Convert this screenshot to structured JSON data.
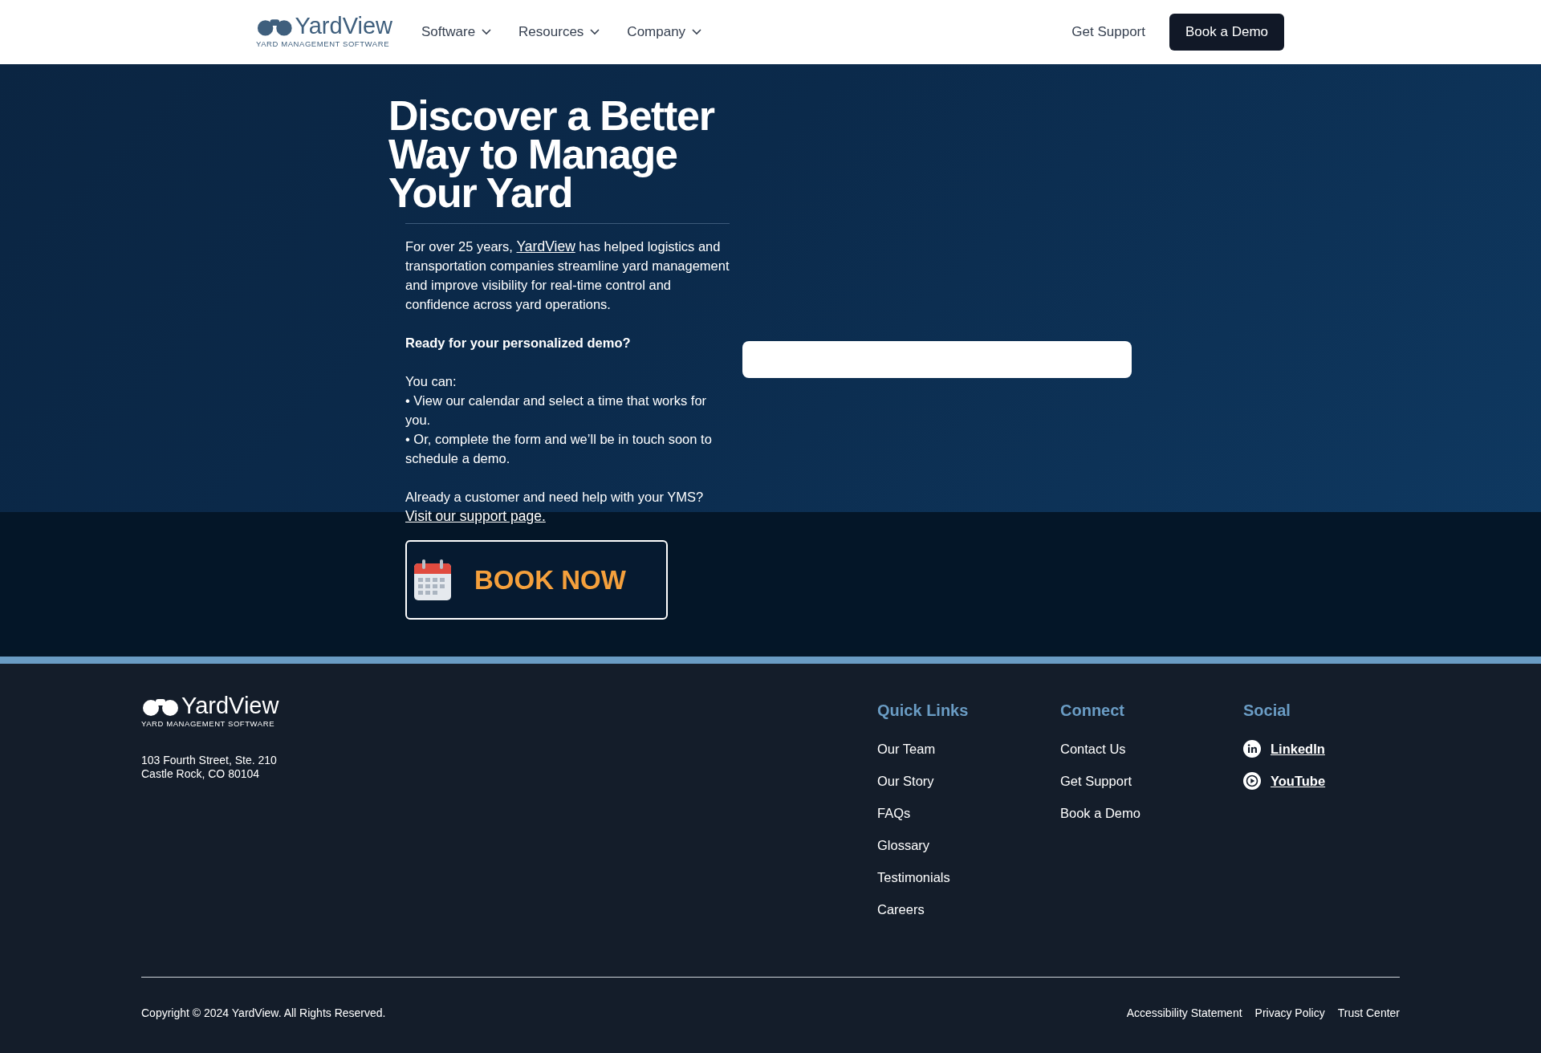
{
  "header": {
    "logo": {
      "wordmark": "**Yard**View",
      "tagline": "YARD MANAGEMENT SOFTWARE"
    },
    "nav": [
      {
        "label": "Software"
      },
      {
        "label": "Resources"
      },
      {
        "label": "Company"
      }
    ],
    "support_link": "Get Support",
    "demo_button": "Book a Demo"
  },
  "hero": {
    "title": "Discover a Better Way to Manage Your Yard",
    "intro": {
      "lead": "For over 25 years,",
      "link": "YardView",
      "rest": "has helped logistics and transportation companies streamline yard management and improve visibility for real-time control and confidence across yard operations."
    },
    "prompt": "Ready for your personalized demo?",
    "options_label": "You can:",
    "options": [
      "• View our calendar and select a time that works for you.",
      "• Or, complete the form and we’ll be in touch soon to schedule a demo."
    ],
    "customer_note": "Already a customer and need help with your YMS?",
    "support_link": "Visit our support page.",
    "book_button": "BOOK NOW"
  },
  "footer": {
    "logo": {
      "wordmark": "**Yard**View",
      "tagline": "YARD MANAGEMENT SOFTWARE"
    },
    "address": [
      "103 Fourth Street, Ste. 210",
      "Castle Rock, CO 80104"
    ],
    "columns": [
      {
        "title": "Quick Links",
        "links": [
          {
            "label": "Our Team"
          },
          {
            "label": "Our Story"
          },
          {
            "label": "FAQs"
          },
          {
            "label": "Glossary"
          },
          {
            "label": "Testimonials"
          },
          {
            "label": "Careers"
          }
        ]
      },
      {
        "title": "Connect",
        "links": [
          {
            "label": "Contact Us"
          },
          {
            "label": "Get Support"
          },
          {
            "label": "Book a Demo"
          }
        ]
      },
      {
        "title": "Social",
        "links": [
          {
            "label": "LinkedIn",
            "kind": "linkedin"
          },
          {
            "label": "YouTube",
            "kind": "youtube"
          }
        ]
      }
    ],
    "copyright": "Copyright © 2024 YardView. All Rights Reserved.",
    "legal_links": [
      "Accessibility Statement",
      "Privacy Policy",
      "Trust Center"
    ]
  }
}
